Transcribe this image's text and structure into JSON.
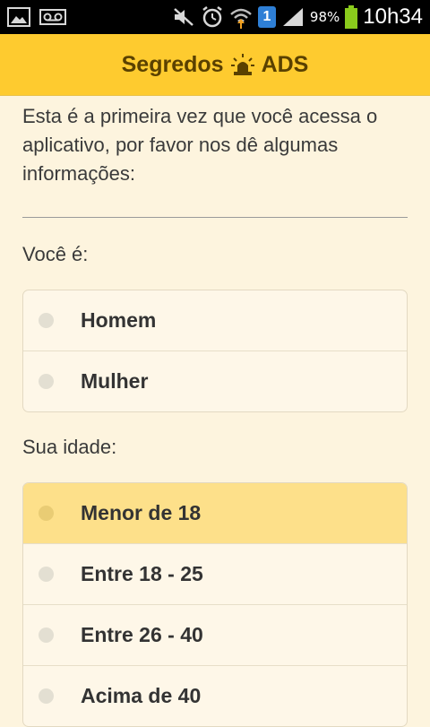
{
  "status_bar": {
    "left_icons": [
      "image-icon",
      "voicemail-icon"
    ],
    "right_icons": [
      "mute-icon",
      "alarm-icon",
      "wifi-icon",
      "notification-one-icon",
      "signal-icon",
      "battery-icon"
    ],
    "notification_badge": "1",
    "battery_percent": "98%",
    "time": "10h34"
  },
  "header": {
    "title_left": "Segredos",
    "title_right": "ADS",
    "siren_icon": "siren-icon",
    "bg_color": "#fecb2f"
  },
  "intro": {
    "text": "Esta é a primeira vez que você acessa o aplicativo, por favor nos dê algumas informações:"
  },
  "gender": {
    "question": "Você é:",
    "options": [
      {
        "label": "Homem",
        "selected": false
      },
      {
        "label": "Mulher",
        "selected": false
      }
    ]
  },
  "age": {
    "question": "Sua idade:",
    "options": [
      {
        "label": "Menor de 18",
        "selected": true
      },
      {
        "label": "Entre 18 - 25",
        "selected": false
      },
      {
        "label": "Entre 26 - 40",
        "selected": false
      },
      {
        "label": "Acima de 40",
        "selected": false
      }
    ]
  }
}
